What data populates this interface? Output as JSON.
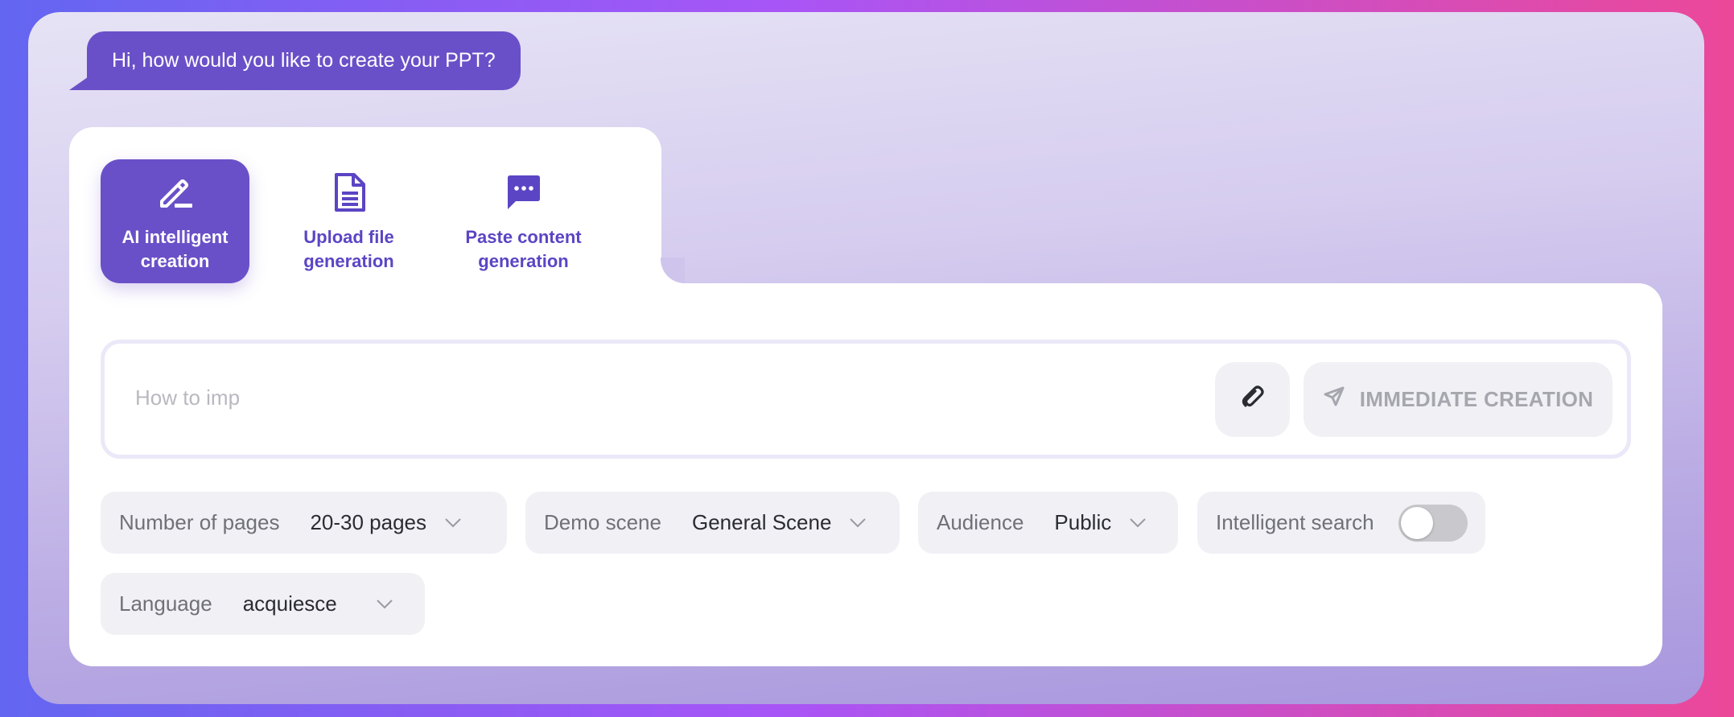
{
  "greeting": "Hi, how would you like to create your PPT?",
  "modes": [
    {
      "label": "AI intelligent creation",
      "icon": "pen-icon",
      "active": true
    },
    {
      "label": "Upload file generation",
      "icon": "document-icon",
      "active": false
    },
    {
      "label": "Paste content generation",
      "icon": "chat-bubble-icon",
      "active": false
    }
  ],
  "prompt": {
    "placeholder": "How to imp",
    "value": ""
  },
  "create_button": {
    "label": "IMMEDIATE CREATION",
    "icon": "send-icon"
  },
  "attach_button": {
    "icon": "paperclip-icon"
  },
  "options": {
    "pages": {
      "label": "Number of pages",
      "value": "20-30 pages"
    },
    "scene": {
      "label": "Demo scene",
      "value": "General Scene"
    },
    "audience": {
      "label": "Audience",
      "value": "Public"
    },
    "search": {
      "label": "Intelligent search",
      "enabled": false
    },
    "language": {
      "label": "Language",
      "value": "acquiesce"
    }
  },
  "colors": {
    "accent": "#6a50c8",
    "muted_button": "#f1f0f5"
  }
}
